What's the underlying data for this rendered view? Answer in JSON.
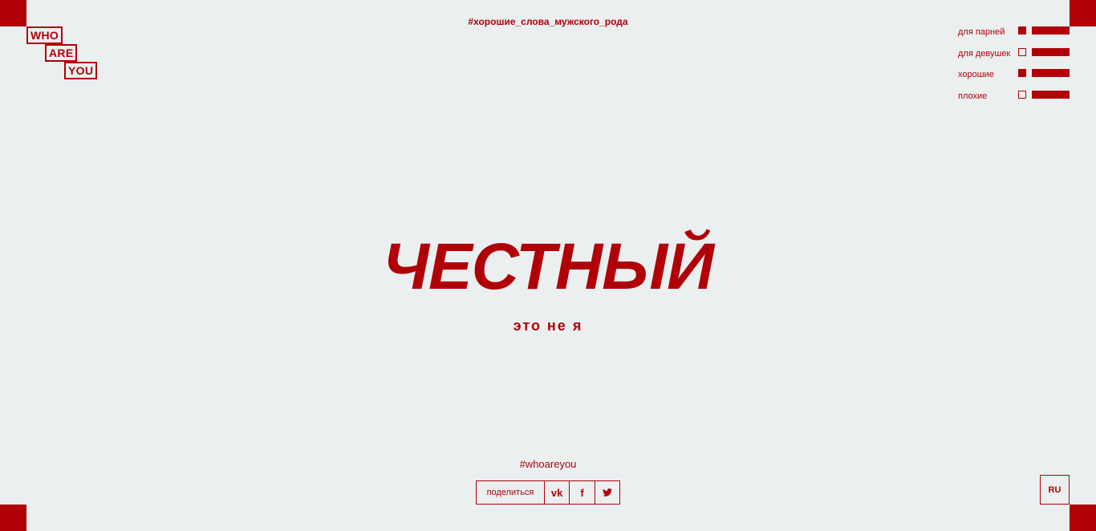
{
  "logo": {
    "line1": "WHO",
    "line2": "ARE",
    "line3": "YOU"
  },
  "header": {
    "hashtag": "#хорошие_слова_мужского_рода"
  },
  "filters": [
    {
      "label": "для парней",
      "checked": true
    },
    {
      "label": "для девушек",
      "checked": false
    },
    {
      "label": "хорошие",
      "checked": true
    },
    {
      "label": "плохие",
      "checked": false
    }
  ],
  "main": {
    "word": "ЧЕСТНЫЙ",
    "subtitle": "это не я"
  },
  "footer": {
    "hashtag": "#whoareyou",
    "share_label": "поделиться",
    "vk_icon": "vk-icon",
    "facebook_icon": "facebook-icon",
    "twitter_icon": "twitter-icon",
    "lang": "RU"
  },
  "colors": {
    "accent": "#b00008",
    "background": "#eceff0"
  }
}
